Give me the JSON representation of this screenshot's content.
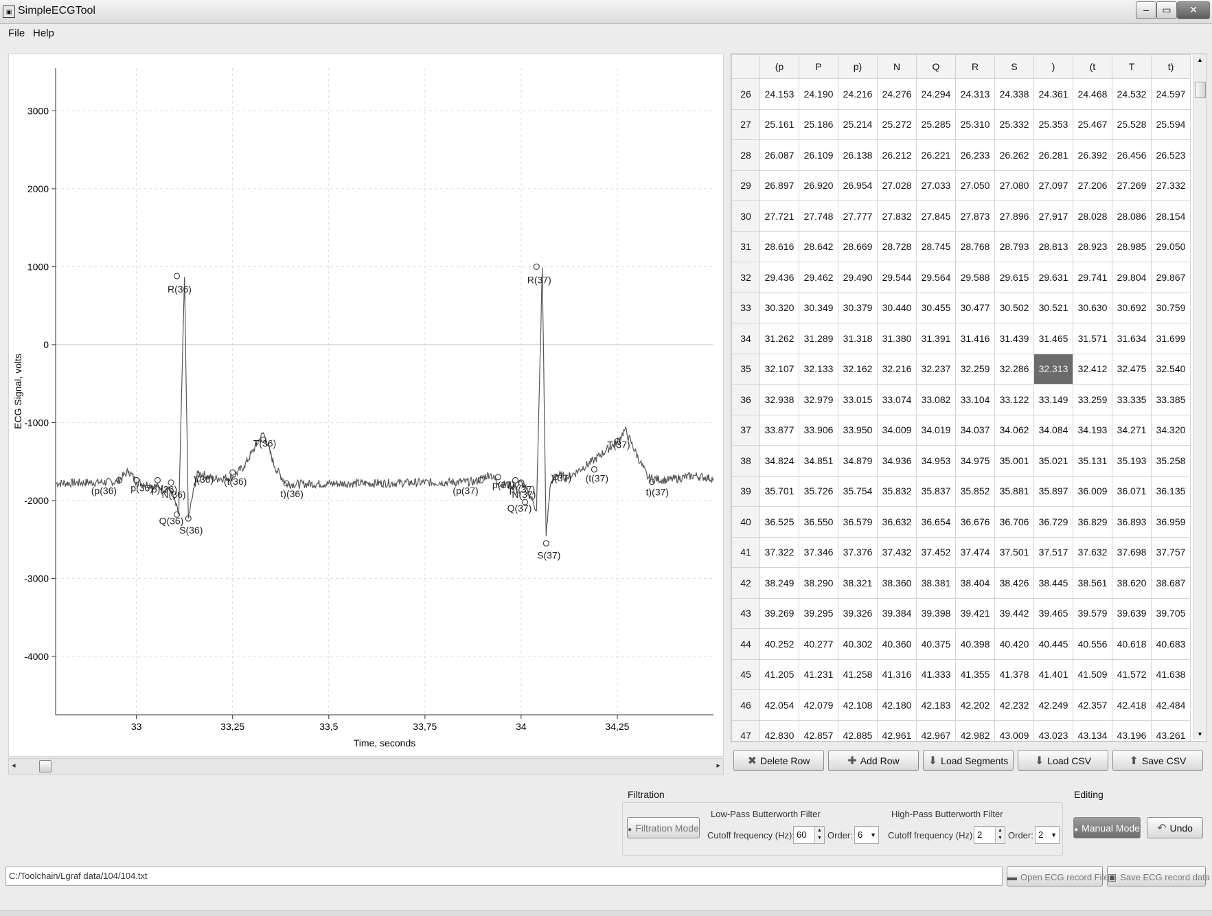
{
  "window": {
    "title": "SimpleECGTool",
    "icon_name": "app-icon",
    "controls": {
      "minimize": "–",
      "maximize": "▭",
      "close": "✕"
    }
  },
  "menu": [
    "File",
    "Help"
  ],
  "chart_data": {
    "type": "line",
    "xlabel": "Time, seconds",
    "ylabel": "ECG Signal, volts",
    "xlim": [
      32.79,
      34.5
    ],
    "ylim": [
      -4750,
      3550
    ],
    "x_ticks": [
      33,
      33.25,
      33.5,
      33.75,
      34,
      34.25
    ],
    "x_tick_labels": [
      "33",
      "33,25",
      "33,5",
      "33,75",
      "34",
      "34,25"
    ],
    "y_ticks": [
      3000,
      2000,
      1000,
      0,
      -1000,
      -2000,
      -3000,
      -4000
    ],
    "y_tick_labels": [
      "3000",
      "2000",
      "1000",
      "0",
      "-1000",
      "-2000",
      "-3000",
      "-4000"
    ],
    "grid": true,
    "series": [
      {
        "baseline": -1780,
        "points": [
          [
            32.79,
            -1780
          ],
          [
            32.95,
            -1760
          ],
          [
            32.98,
            -1620
          ],
          [
            33.0,
            -1760
          ],
          [
            33.06,
            -1830
          ],
          [
            33.09,
            -1870
          ],
          [
            33.11,
            -2180
          ],
          [
            33.125,
            870
          ],
          [
            33.135,
            -2230
          ],
          [
            33.15,
            -1840
          ],
          [
            33.16,
            -1640
          ],
          [
            33.2,
            -1720
          ],
          [
            33.25,
            -1700
          ],
          [
            33.28,
            -1560
          ],
          [
            33.33,
            -1130
          ],
          [
            33.36,
            -1570
          ],
          [
            33.39,
            -1790
          ],
          [
            33.6,
            -1780
          ],
          [
            33.88,
            -1760
          ],
          [
            33.92,
            -1660
          ],
          [
            33.94,
            -1780
          ],
          [
            33.99,
            -1820
          ],
          [
            34.0,
            -1760
          ],
          [
            34.03,
            -2000
          ],
          [
            34.04,
            -2130
          ],
          [
            34.055,
            990
          ],
          [
            34.065,
            -2460
          ],
          [
            34.075,
            -1840
          ],
          [
            34.09,
            -1660
          ],
          [
            34.12,
            -1710
          ],
          [
            34.19,
            -1480
          ],
          [
            34.22,
            -1360
          ],
          [
            34.25,
            -1250
          ],
          [
            34.27,
            -1090
          ],
          [
            34.31,
            -1510
          ],
          [
            34.33,
            -1710
          ],
          [
            34.38,
            -1740
          ],
          [
            34.45,
            -1680
          ],
          [
            34.5,
            -1720
          ]
        ]
      }
    ],
    "annotations": [
      {
        "label": "R(36)",
        "x": 33.105,
        "y": 880
      },
      {
        "label": "(p(36)",
        "x": 32.955,
        "y": -1740
      },
      {
        "label": "p(36)",
        "x": 33.0,
        "y": -1740
      },
      {
        "label": "p)(36)",
        "x": 33.055,
        "y": -1740
      },
      {
        "label": "N(36)",
        "x": 33.09,
        "y": -1770
      },
      {
        "label": "Q(36)",
        "x": 33.105,
        "y": -2180
      },
      {
        "label": "S(36)",
        "x": 33.135,
        "y": -2230
      },
      {
        "label": ")(36)",
        "x": 33.16,
        "y": -1720
      },
      {
        "label": "(t(36)",
        "x": 33.25,
        "y": -1640
      },
      {
        "label": "T(36)",
        "x": 33.33,
        "y": -1220
      },
      {
        "label": "t)(36)",
        "x": 33.39,
        "y": -1780
      },
      {
        "label": "R(37)",
        "x": 34.04,
        "y": 1000
      },
      {
        "label": "(p(37)",
        "x": 33.895,
        "y": -1740
      },
      {
        "label": "p(37)",
        "x": 33.94,
        "y": -1700
      },
      {
        "label": "p)(37)",
        "x": 33.985,
        "y": -1740
      },
      {
        "label": "N(37)",
        "x": 34.0,
        "y": -1770
      },
      {
        "label": "Q(37)",
        "x": 34.01,
        "y": -2020
      },
      {
        "label": "S(37)",
        "x": 34.065,
        "y": -2550
      },
      {
        "label": ")(37)",
        "x": 34.09,
        "y": -1700
      },
      {
        "label": "(t(37)",
        "x": 34.19,
        "y": -1600
      },
      {
        "label": "T(37)",
        "x": 34.25,
        "y": -1240
      },
      {
        "label": "t)(37)",
        "x": 34.34,
        "y": -1760
      }
    ]
  },
  "chart_scrollbar": {
    "left_arrow": "◂",
    "right_arrow": "▸"
  },
  "table": {
    "columns": [
      "(p",
      "P",
      "p)",
      "N",
      "Q",
      "R",
      "S",
      ")",
      "(t",
      "T",
      "t)"
    ],
    "rows": [
      {
        "id": "26",
        "cells": [
          "24.153",
          "24.190",
          "24.216",
          "24.276",
          "24.294",
          "24.313",
          "24.338",
          "24.361",
          "24.468",
          "24.532",
          "24.597"
        ]
      },
      {
        "id": "27",
        "cells": [
          "25.161",
          "25.186",
          "25.214",
          "25.272",
          "25.285",
          "25.310",
          "25.332",
          "25.353",
          "25.467",
          "25.528",
          "25.594"
        ]
      },
      {
        "id": "28",
        "cells": [
          "26.087",
          "26.109",
          "26.138",
          "26.212",
          "26.221",
          "26.233",
          "26.262",
          "26.281",
          "26.392",
          "26.456",
          "26.523"
        ]
      },
      {
        "id": "29",
        "cells": [
          "26.897",
          "26.920",
          "26.954",
          "27.028",
          "27.033",
          "27.050",
          "27.080",
          "27.097",
          "27.206",
          "27.269",
          "27.332"
        ]
      },
      {
        "id": "30",
        "cells": [
          "27.721",
          "27.748",
          "27.777",
          "27.832",
          "27.845",
          "27.873",
          "27.896",
          "27.917",
          "28.028",
          "28.086",
          "28.154"
        ]
      },
      {
        "id": "31",
        "cells": [
          "28.616",
          "28.642",
          "28.669",
          "28.728",
          "28.745",
          "28.768",
          "28.793",
          "28.813",
          "28.923",
          "28.985",
          "29.050"
        ]
      },
      {
        "id": "32",
        "cells": [
          "29.436",
          "29.462",
          "29.490",
          "29.544",
          "29.564",
          "29.588",
          "29.615",
          "29.631",
          "29.741",
          "29.804",
          "29.867"
        ]
      },
      {
        "id": "33",
        "cells": [
          "30.320",
          "30.349",
          "30.379",
          "30.440",
          "30.455",
          "30.477",
          "30.502",
          "30.521",
          "30.630",
          "30.692",
          "30.759"
        ]
      },
      {
        "id": "34",
        "cells": [
          "31.262",
          "31.289",
          "31.318",
          "31.380",
          "31.391",
          "31.416",
          "31.439",
          "31.465",
          "31.571",
          "31.634",
          "31.699"
        ]
      },
      {
        "id": "35",
        "cells": [
          "32.107",
          "32.133",
          "32.162",
          "32.216",
          "32.237",
          "32.259",
          "32.286",
          "32.313",
          "32.412",
          "32.475",
          "32.540"
        ],
        "selected_col": 7
      },
      {
        "id": "36",
        "cells": [
          "32.938",
          "32.979",
          "33.015",
          "33.074",
          "33.082",
          "33.104",
          "33.122",
          "33.149",
          "33.259",
          "33.335",
          "33.385"
        ]
      },
      {
        "id": "37",
        "cells": [
          "33.877",
          "33.906",
          "33.950",
          "34.009",
          "34.019",
          "34.037",
          "34.062",
          "34.084",
          "34.193",
          "34.271",
          "34.320"
        ]
      },
      {
        "id": "38",
        "cells": [
          "34.824",
          "34.851",
          "34.879",
          "34.936",
          "34.953",
          "34.975",
          "35.001",
          "35.021",
          "35.131",
          "35.193",
          "35.258"
        ]
      },
      {
        "id": "39",
        "cells": [
          "35.701",
          "35.726",
          "35.754",
          "35.832",
          "35.837",
          "35.852",
          "35.881",
          "35.897",
          "36.009",
          "36.071",
          "36.135"
        ]
      },
      {
        "id": "40",
        "cells": [
          "36.525",
          "36.550",
          "36.579",
          "36.632",
          "36.654",
          "36.676",
          "36.706",
          "36.729",
          "36.829",
          "36.893",
          "36.959"
        ]
      },
      {
        "id": "41",
        "cells": [
          "37.322",
          "37.346",
          "37.376",
          "37.432",
          "37.452",
          "37.474",
          "37.501",
          "37.517",
          "37.632",
          "37.698",
          "37.757"
        ]
      },
      {
        "id": "42",
        "cells": [
          "38.249",
          "38.290",
          "38.321",
          "38.360",
          "38.381",
          "38.404",
          "38.426",
          "38.445",
          "38.561",
          "38.620",
          "38.687"
        ]
      },
      {
        "id": "43",
        "cells": [
          "39.269",
          "39.295",
          "39.326",
          "39.384",
          "39.398",
          "39.421",
          "39.442",
          "39.465",
          "39.579",
          "39.639",
          "39.705"
        ]
      },
      {
        "id": "44",
        "cells": [
          "40.252",
          "40.277",
          "40.302",
          "40.360",
          "40.375",
          "40.398",
          "40.420",
          "40.445",
          "40.556",
          "40.618",
          "40.683"
        ]
      },
      {
        "id": "45",
        "cells": [
          "41.205",
          "41.231",
          "41.258",
          "41.316",
          "41.333",
          "41.355",
          "41.378",
          "41.401",
          "41.509",
          "41.572",
          "41.638"
        ]
      },
      {
        "id": "46",
        "cells": [
          "42.054",
          "42.079",
          "42.108",
          "42.180",
          "42.183",
          "42.202",
          "42.232",
          "42.249",
          "42.357",
          "42.418",
          "42.484"
        ]
      },
      {
        "id": "47",
        "cells": [
          "42.830",
          "42.857",
          "42.885",
          "42.961",
          "42.967",
          "42.982",
          "43.009",
          "43.023",
          "43.134",
          "43.196",
          "43.261"
        ]
      }
    ]
  },
  "table_buttons": [
    {
      "label": "Delete Row",
      "icon": "delete-icon",
      "glyph": "✖"
    },
    {
      "label": "Add Row",
      "icon": "add-icon",
      "glyph": "✚"
    },
    {
      "label": "Load Segments",
      "icon": "download-arrow-icon",
      "glyph": "⬇"
    },
    {
      "label": "Load CSV",
      "icon": "download-arrow-icon",
      "glyph": "⬇"
    },
    {
      "label": "Save CSV",
      "icon": "upload-arrow-icon",
      "glyph": "⬆"
    }
  ],
  "filtration": {
    "title": "Filtration",
    "mode_button": "Filtration Mode",
    "lowpass": {
      "title": "Low-Pass Butterworth Filter",
      "cutoff_label": "Cutoff frequency (Hz):",
      "cutoff_value": "60",
      "order_label": "Order:",
      "order_value": "6"
    },
    "highpass": {
      "title": "High-Pass Butterworth Filter",
      "cutoff_label": "Cutoff frequency (Hz):",
      "cutoff_value": "2",
      "order_label": "Order:",
      "order_value": "2"
    }
  },
  "editing": {
    "title": "Editing",
    "manual_mode": "Manual Mode",
    "undo": "Undo"
  },
  "file": {
    "path": "C:/Toolchain/Lgraf data/104/104.txt",
    "open_button": "Open ECG record File",
    "save_button": "Save ECG record data"
  },
  "colors": {
    "signal": "#555555",
    "grid": "#dcdcdc",
    "selected_cell": "#6b6b6b",
    "window_bg": "#ececec"
  }
}
